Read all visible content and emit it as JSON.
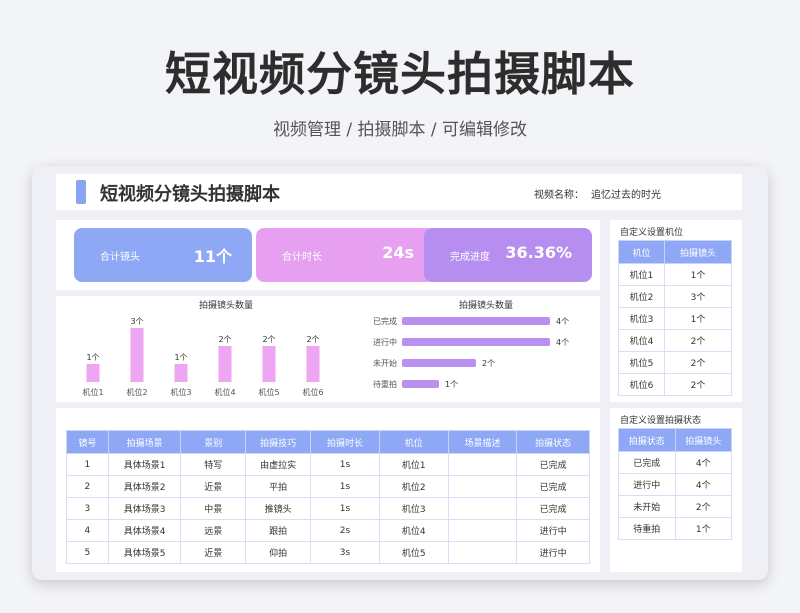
{
  "page": {
    "title": "短视频分镜头拍摄脚本",
    "subtitle": "视频管理 / 拍摄脚本 /  可编辑修改"
  },
  "header": {
    "title": "短视频分镜头拍摄脚本",
    "video_name_label": "视频名称：",
    "video_name_value": "追忆过去的时光"
  },
  "stats": [
    {
      "label": "合计镜头",
      "value": "11个"
    },
    {
      "label": "合计时长",
      "value": "24s"
    },
    {
      "label": "完成进度",
      "value": "36.36%"
    }
  ],
  "colors": {
    "blue": "#8ea8f6",
    "pink": "#e7a0f0",
    "purple": "#b68ef0",
    "bar_pink": "#eea6f3",
    "bar_purple": "#b98ff0"
  },
  "chart_data": [
    {
      "type": "bar",
      "title": "拍摄镜头数量",
      "categories": [
        "机位1",
        "机位2",
        "机位3",
        "机位4",
        "机位5",
        "机位6"
      ],
      "values": [
        1,
        3,
        1,
        2,
        2,
        2
      ],
      "data_labels": [
        "1个",
        "3个",
        "1个",
        "2个",
        "2个",
        "2个"
      ]
    },
    {
      "type": "bar",
      "orientation": "horizontal",
      "title": "拍摄镜头数量",
      "categories": [
        "已完成",
        "进行中",
        "未开始",
        "待重拍"
      ],
      "values": [
        4,
        4,
        2,
        1
      ],
      "data_labels": [
        "4个",
        "4个",
        "2个",
        "1个"
      ]
    }
  ],
  "main_table": {
    "headers": [
      "镜号",
      "拍摄场景",
      "景别",
      "拍摄技巧",
      "拍摄时长",
      "机位",
      "场景描述",
      "拍摄状态"
    ],
    "rows": [
      [
        "1",
        "具体场景1",
        "特写",
        "由虚拉实",
        "1s",
        "机位1",
        "",
        "已完成"
      ],
      [
        "2",
        "具体场景2",
        "近景",
        "平拍",
        "1s",
        "机位2",
        "",
        "已完成"
      ],
      [
        "3",
        "具体场景3",
        "中景",
        "推镜头",
        "1s",
        "机位3",
        "",
        "已完成"
      ],
      [
        "4",
        "具体场景4",
        "远景",
        "跟拍",
        "2s",
        "机位4",
        "",
        "进行中"
      ],
      [
        "5",
        "具体场景5",
        "近景",
        "仰拍",
        "3s",
        "机位5",
        "",
        "进行中"
      ]
    ]
  },
  "side_camera": {
    "title": "自定义设置机位",
    "headers": [
      "机位",
      "拍摄镜头"
    ],
    "rows": [
      [
        "机位1",
        "1个"
      ],
      [
        "机位2",
        "3个"
      ],
      [
        "机位3",
        "1个"
      ],
      [
        "机位4",
        "2个"
      ],
      [
        "机位5",
        "2个"
      ],
      [
        "机位6",
        "2个"
      ]
    ]
  },
  "side_status": {
    "title": "自定义设置拍摄状态",
    "headers": [
      "拍摄状态",
      "拍摄镜头"
    ],
    "rows": [
      [
        "已完成",
        "4个"
      ],
      [
        "进行中",
        "4个"
      ],
      [
        "未开始",
        "2个"
      ],
      [
        "待重拍",
        "1个"
      ]
    ]
  }
}
